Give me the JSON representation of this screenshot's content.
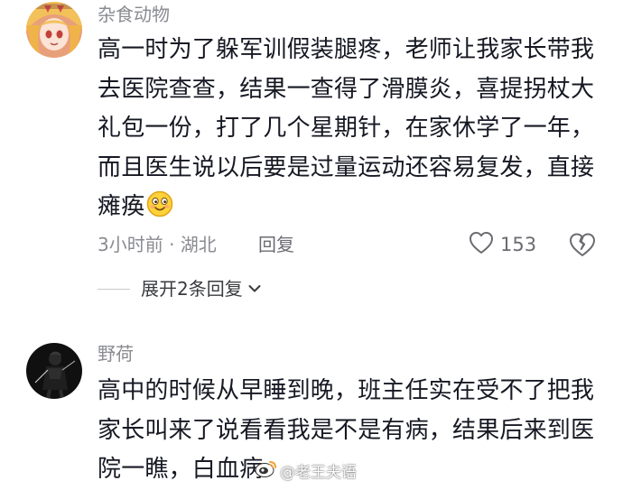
{
  "comments": [
    {
      "username": "杂食动物",
      "lines": [
        "高一时为了躲军训假装腿疼，老师让我家长带我",
        "去医院查查，结果一查得了滑膜炎，喜提拐杖大",
        "礼包一份，打了几个星期针，在家休学了一年，",
        "而且医生说以后要是过量运动还容易复发，直接",
        "瘫痪"
      ],
      "emoji": "smiling-face-emoji",
      "meta": "3小时前 · 湖北",
      "reply_label": "回复",
      "like_count": "153",
      "expand_label": "展开2条回复"
    },
    {
      "username": "野荷",
      "lines": [
        "高中的时候从早睡到晚，班主任实在受不了把我",
        "家长叫来了说看看我是不是有病，结果后来到医",
        "院一瞧，白血病"
      ]
    }
  ],
  "watermark": {
    "text": "@老王夫语",
    "icon": "weibo-logo"
  },
  "colors": {
    "text": "#161823",
    "secondary": "#8a8b91",
    "background": "#ffffff"
  }
}
